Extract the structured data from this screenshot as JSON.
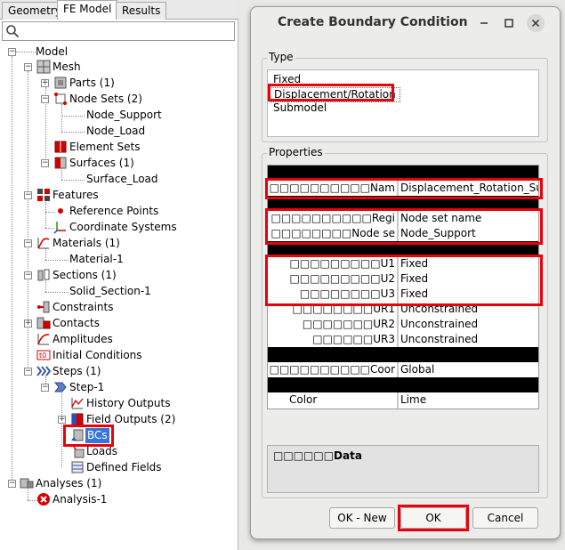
{
  "left_panel": {
    "tabs": [
      "Geometry",
      "FE Model",
      "Results"
    ],
    "active_tab": "FE Model",
    "search_value": "",
    "tree": {
      "model": "Model",
      "mesh": "Mesh",
      "parts": "Parts (1)",
      "node_sets": "Node Sets (2)",
      "node_support": "Node_Support",
      "node_load": "Node_Load",
      "element_sets": "Element Sets",
      "surfaces": "Surfaces (1)",
      "surface_load": "Surface_Load",
      "features": "Features",
      "reference_points": "Reference Points",
      "coordinate_systems": "Coordinate Systems",
      "materials": "Materials (1)",
      "material_1": "Material-1",
      "sections": "Sections (1)",
      "solid_section_1": "Solid_Section-1",
      "constraints": "Constraints",
      "contacts": "Contacts",
      "amplitudes": "Amplitudes",
      "initial_conditions": "Initial Conditions",
      "steps": "Steps (1)",
      "step_1": "Step-1",
      "history_outputs": "History Outputs",
      "field_outputs": "Field Outputs (2)",
      "bcs": "BCs",
      "loads": "Loads",
      "defined_fields": "Defined Fields",
      "analyses": "Analyses (1)",
      "analysis_1": "Analysis-1"
    }
  },
  "dialog": {
    "title": "Create Boundary Condition",
    "window_controls": [
      "minimize-icon",
      "maximize-icon",
      "close-icon"
    ],
    "type_group": {
      "label": "Type",
      "options": [
        "Fixed",
        "Displacement/Rotation",
        "Submodel"
      ],
      "selected": "Displacement/Rotation"
    },
    "properties_group": {
      "label": "Properties",
      "rows": [
        {
          "k": "",
          "v": "",
          "black": true
        },
        {
          "k": "□□□□□□□□□□Nam",
          "v": "Displacement_Rotation_Sup",
          "black": false
        },
        {
          "k": "",
          "v": "",
          "black": true
        },
        {
          "k": "□□□□□□□□□□Regi",
          "v": "Node set name",
          "black": false
        },
        {
          "k": "□□□□□□□□Node se",
          "v": "Node_Support",
          "black": false
        },
        {
          "k": "",
          "v": "",
          "black": true
        },
        {
          "k": "□□□□□□□□□U1",
          "v": "Fixed",
          "black": false
        },
        {
          "k": "□□□□□□□□□U2",
          "v": "Fixed",
          "black": false
        },
        {
          "k": "□□□□□□□□U3",
          "v": "Fixed",
          "black": false
        },
        {
          "k": "□□□□□□□□UR1",
          "v": "Unconstrained",
          "black": false
        },
        {
          "k": "□□□□□□□UR2",
          "v": "Unconstrained",
          "black": false
        },
        {
          "k": "□□□□□□UR3",
          "v": "Unconstrained",
          "black": false
        },
        {
          "k": "",
          "v": "",
          "black": true
        },
        {
          "k": "□□□□□□□□□□Coor",
          "v": "Global",
          "black": false
        },
        {
          "k": "",
          "v": "",
          "black": true
        },
        {
          "k": "Color",
          "v": "Lime",
          "black": false
        }
      ]
    },
    "description": "□□□□□□Data",
    "buttons": {
      "ok_new": "OK - New",
      "ok": "OK",
      "cancel": "Cancel"
    }
  },
  "colors": {
    "highlight": "#e8000b",
    "selection": "#3875d7",
    "dialog_bg": "#ececea"
  }
}
